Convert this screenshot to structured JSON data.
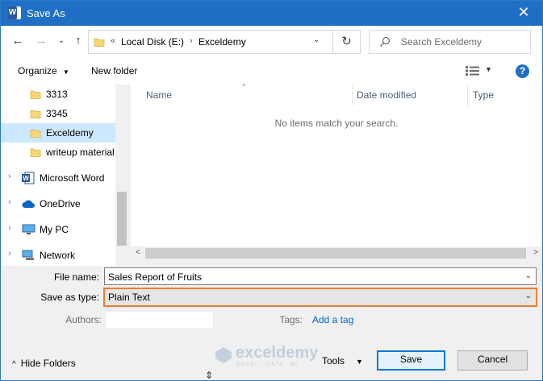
{
  "window": {
    "title": "Save As",
    "close_glyph": "✕",
    "app_icon_letter": "W"
  },
  "nav_buttons": {
    "back": "←",
    "forward": "→",
    "up": "↑",
    "dropdown": "⌄"
  },
  "address": {
    "overflow": "«",
    "crumbs": [
      "Local Disk (E:)",
      "Exceldemy"
    ],
    "separator": "›",
    "dropdown": "⌄",
    "refresh": "↻"
  },
  "search": {
    "placeholder": "Search Exceldemy"
  },
  "toolbar": {
    "organize_label": "Organize",
    "organize_caret": "▼",
    "new_folder_label": "New folder",
    "view_caret": "▼",
    "help": "?"
  },
  "sidebar": {
    "items": [
      {
        "label": "3313",
        "icon": "folder-icon",
        "selected": false
      },
      {
        "label": "3345",
        "icon": "folder-icon",
        "selected": false
      },
      {
        "label": "Exceldemy",
        "icon": "folder-icon",
        "selected": true
      },
      {
        "label": "writeup material",
        "icon": "folder-icon",
        "selected": false
      },
      {
        "label": "Microsoft Word",
        "icon": "word-icon",
        "selected": false
      },
      {
        "label": "OneDrive",
        "icon": "cloud-icon",
        "selected": false
      },
      {
        "label": "My PC",
        "icon": "pc-icon",
        "selected": false
      },
      {
        "label": "Network",
        "icon": "network-icon",
        "selected": false
      }
    ],
    "expander": "›"
  },
  "file_list": {
    "columns": [
      "Name",
      "Date modified",
      "Type"
    ],
    "empty_message": "No items match your search.",
    "sort_arrow": "^"
  },
  "hscroll": {
    "left": "<",
    "right": ">"
  },
  "form": {
    "file_name_label": "File name:",
    "file_name_value": "Sales Report of Fruits",
    "save_type_label": "Save as type:",
    "save_type_value": "Plain Text",
    "authors_label": "Authors:",
    "tags_label": "Tags:",
    "add_tag_label": "Add a tag",
    "caret": "⌄"
  },
  "footer": {
    "hide_folders_label": "Hide Folders",
    "hide_folders_chevron": "^",
    "tools_label": "Tools",
    "tools_caret": "▼",
    "save_label": "Save",
    "cancel_label": "Cancel"
  },
  "watermark": {
    "brand": "exceldemy",
    "tagline": "EXCEL · DATA · BI"
  },
  "colors": {
    "accent": "#0078d7",
    "title_bar": "#1e6fc5",
    "highlight": "#ed7d31",
    "selection": "#cce8ff",
    "folder": "#f8d775"
  }
}
